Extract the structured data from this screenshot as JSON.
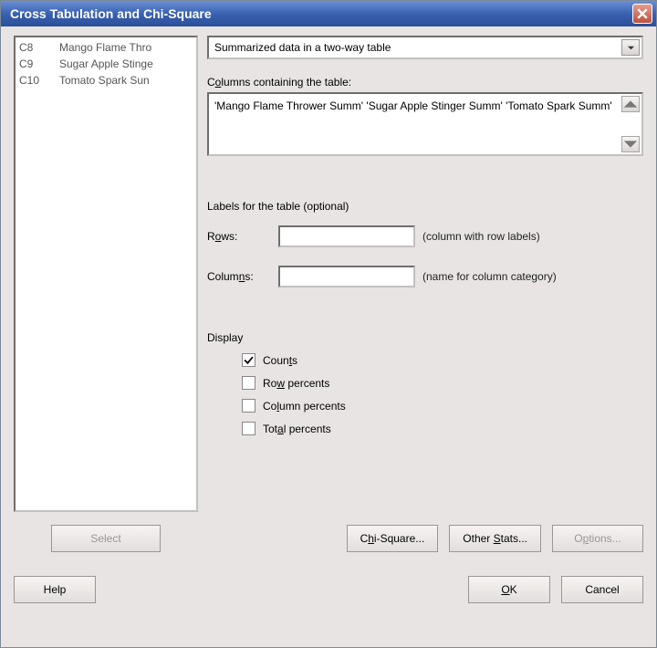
{
  "window": {
    "title": "Cross Tabulation and Chi-Square"
  },
  "varlist": {
    "items": [
      {
        "id": "C8",
        "name": "Mango Flame Thro"
      },
      {
        "id": "C9",
        "name": "Sugar Apple Stinge"
      },
      {
        "id": "C10",
        "name": "Tomato Spark Sun"
      }
    ]
  },
  "mode": {
    "selected": "Summarized data in a two-way table"
  },
  "columns_section": {
    "label_pre": "C",
    "label_underline": "o",
    "label_post": "lumns containing the table:",
    "value": "'Mango Flame Thrower Summ' 'Sugar Apple Stinger Summ' 'Tomato Spark Summ'"
  },
  "labels_section": {
    "heading": "Labels for the table (optional)",
    "rows": {
      "pre": "R",
      "u": "o",
      "post": "ws:",
      "value": "",
      "hint": "(column with row labels)"
    },
    "cols": {
      "pre": "Colum",
      "u": "n",
      "post": "s:",
      "value": "",
      "hint": "(name for column category)"
    }
  },
  "display": {
    "heading": "Display",
    "counts": {
      "pre": "Coun",
      "u": "t",
      "post": "s",
      "checked": true
    },
    "row_percents": {
      "pre": "Ro",
      "u": "w",
      "post": " percents",
      "checked": false
    },
    "col_percents": {
      "pre": "Co",
      "u": "l",
      "post": "umn percents",
      "checked": false
    },
    "total_percents": {
      "pre": "Tot",
      "u": "a",
      "post": "l percents",
      "checked": false
    }
  },
  "buttons": {
    "select": {
      "label": "Select",
      "enabled": false
    },
    "chi_square": {
      "pre": "C",
      "u": "h",
      "post": "i-Square...",
      "enabled": true
    },
    "other_stats": {
      "pre": "Other ",
      "u": "S",
      "post": "tats...",
      "enabled": true
    },
    "options": {
      "pre": "O",
      "u": "p",
      "post": "tions...",
      "enabled": false
    },
    "help": {
      "label": "Help",
      "enabled": true
    },
    "ok": {
      "pre": "",
      "u": "O",
      "post": "K",
      "enabled": true
    },
    "cancel": {
      "label": "Cancel",
      "enabled": true
    }
  }
}
